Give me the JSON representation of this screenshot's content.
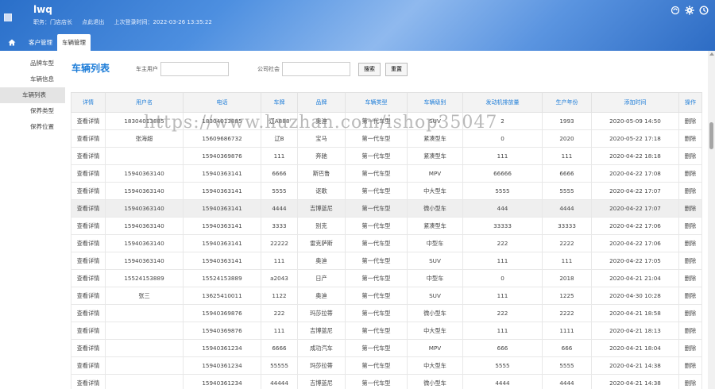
{
  "header": {
    "title": "lwq",
    "role": "职务：门店店长",
    "logout": "点此退出",
    "last_login": "上次登录时间：2022-03-26 13:35:22"
  },
  "tabs": [
    {
      "label": "客户管理",
      "active": false
    },
    {
      "label": "车辆管理",
      "active": true
    }
  ],
  "sidebar": {
    "items": [
      {
        "label": "品牌车型",
        "active": false
      },
      {
        "label": "车辆信息",
        "active": false
      },
      {
        "label": "车辆列表",
        "active": true
      },
      {
        "label": "保养类型",
        "active": false
      },
      {
        "label": "保养位置",
        "active": false
      }
    ]
  },
  "main": {
    "title": "车辆列表",
    "search": {
      "label1": "车主用户",
      "label2": "公司社会",
      "value1": "",
      "value2": "",
      "search_btn": "搜索",
      "reset_btn": "重置"
    },
    "watermark": "https://www.huzhan.com/ishop35047"
  },
  "table": {
    "columns": [
      "详情",
      "用户名",
      "电话",
      "车牌",
      "品牌",
      "车辆类型",
      "车辆级别",
      "发动机排放量",
      "生产年份",
      "添加时间",
      "操作"
    ],
    "rows": [
      [
        "查看详情",
        "18304013885",
        "18304013885",
        "辽A888",
        "奥迪",
        "第一代车型",
        "SUV",
        "2",
        "1993",
        "2020-05-09 14:50",
        "删除"
      ],
      [
        "查看详情",
        "张海超",
        "15609686732",
        "辽B",
        "宝马",
        "第一代车型",
        "紧凑型车",
        "0",
        "2020",
        "2020-05-22 17:18",
        "删除"
      ],
      [
        "查看详情",
        "",
        "15940369876",
        "111",
        "奔驰",
        "第一代车型",
        "紧凑型车",
        "111",
        "111",
        "2020-04-22 18:18",
        "删除"
      ],
      [
        "查看详情",
        "15940363140",
        "15940363141",
        "6666",
        "斯巴鲁",
        "第一代车型",
        "MPV",
        "66666",
        "6666",
        "2020-04-22 17:08",
        "删除"
      ],
      [
        "查看详情",
        "15940363140",
        "15940363141",
        "5555",
        "讴歌",
        "第一代车型",
        "中大型车",
        "5555",
        "5555",
        "2020-04-22 17:07",
        "删除"
      ],
      [
        "查看详情",
        "15940363140",
        "15940363141",
        "4444",
        "吉博蓝尼",
        "第一代车型",
        "微小型车",
        "444",
        "4444",
        "2020-04-22 17:07",
        "删除"
      ],
      [
        "查看详情",
        "15940363140",
        "15940363141",
        "3333",
        "别克",
        "第一代车型",
        "紧凑型车",
        "33333",
        "33333",
        "2020-04-22 17:06",
        "删除"
      ],
      [
        "查看详情",
        "15940363140",
        "15940363141",
        "22222",
        "雷克萨斯",
        "第一代车型",
        "中型车",
        "222",
        "2222",
        "2020-04-22 17:06",
        "删除"
      ],
      [
        "查看详情",
        "15940363140",
        "15940363141",
        "111",
        "奥迪",
        "第一代车型",
        "SUV",
        "111",
        "111",
        "2020-04-22 17:05",
        "删除"
      ],
      [
        "查看详情",
        "15524153889",
        "15524153889",
        "a2043",
        "日产",
        "第一代车型",
        "中型车",
        "0",
        "2018",
        "2020-04-21 21:04",
        "删除"
      ],
      [
        "查看详情",
        "张三",
        "13625410011",
        "1122",
        "奥迪",
        "第一代车型",
        "SUV",
        "111",
        "1225",
        "2020-04-30 10:28",
        "删除"
      ],
      [
        "查看详情",
        "",
        "15940369876",
        "222",
        "玛莎拉蒂",
        "第一代车型",
        "微小型车",
        "222",
        "2222",
        "2020-04-21 18:58",
        "删除"
      ],
      [
        "查看详情",
        "",
        "15940369876",
        "111",
        "吉博蓝尼",
        "第一代车型",
        "中大型车",
        "111",
        "1111",
        "2020-04-21 18:13",
        "删除"
      ],
      [
        "查看详情",
        "",
        "15940361234",
        "6666",
        "成功汽车",
        "第一代车型",
        "MPV",
        "666",
        "666",
        "2020-04-21 18:04",
        "删除"
      ],
      [
        "查看详情",
        "",
        "15940361234",
        "55555",
        "玛莎拉蒂",
        "第一代车型",
        "中大型车",
        "5555",
        "5555",
        "2020-04-21 14:38",
        "删除"
      ],
      [
        "查看详情",
        "",
        "15940361234",
        "44444",
        "吉博蓝尼",
        "第一代车型",
        "微小型车",
        "4444",
        "4444",
        "2020-04-21 14:38",
        "删除"
      ]
    ],
    "highlight_row": 5
  }
}
